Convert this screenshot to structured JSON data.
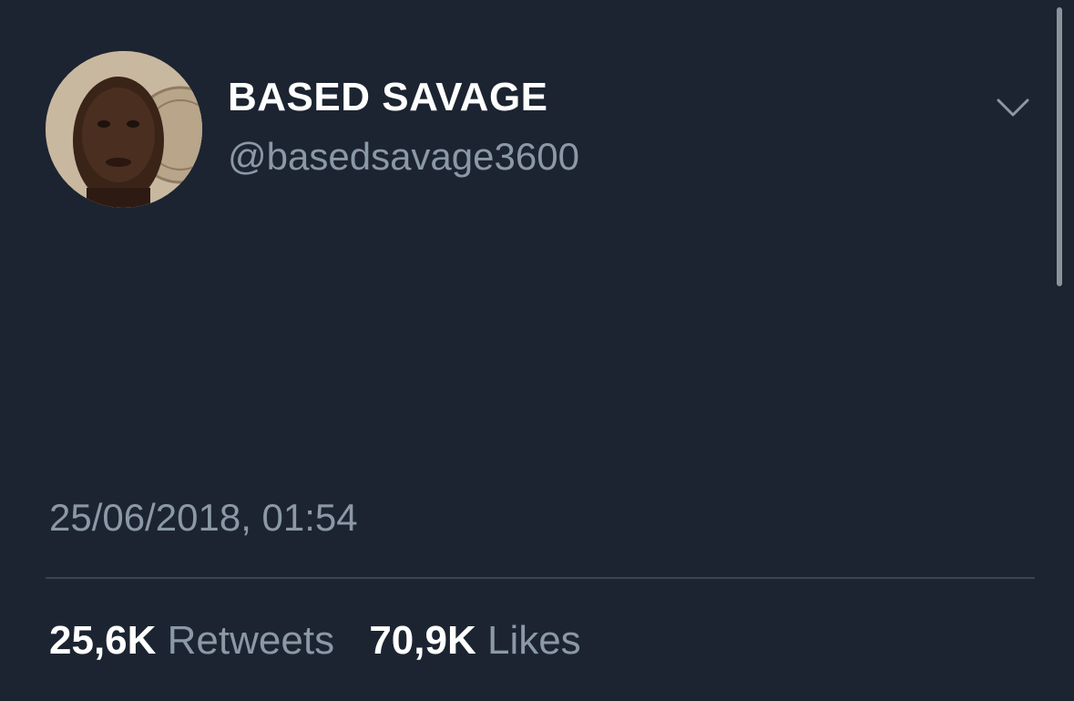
{
  "user": {
    "display_name": "BASED SAVAGE",
    "handle": "@basedsavage3600",
    "avatar_icon": "profile-photo"
  },
  "tweet": {
    "timestamp": "25/06/2018, 01:54",
    "retweets_count": "25,6K",
    "retweets_label": "Retweets",
    "likes_count": "70,9K",
    "likes_label": "Likes"
  },
  "icons": {
    "menu": "chevron-down-icon"
  },
  "colors": {
    "background": "#1c2431",
    "secondary_text": "#8b98a6",
    "primary_text": "#ffffff"
  }
}
